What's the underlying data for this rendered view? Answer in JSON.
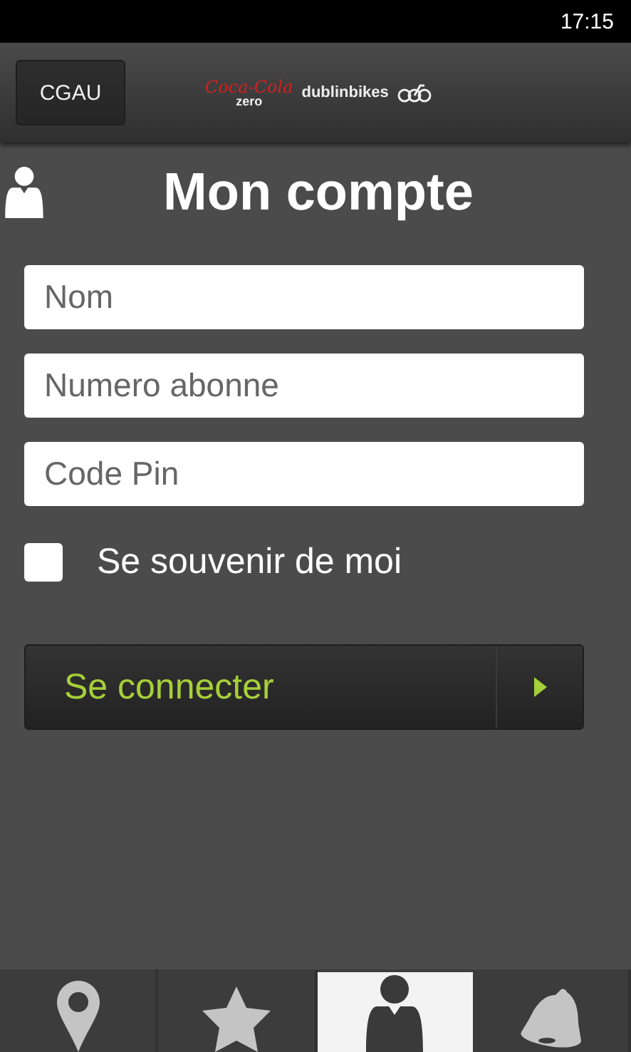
{
  "status_bar": {
    "time": "17:15"
  },
  "header": {
    "account_button": "CGAU",
    "logo": {
      "brand": "Coca-Cola",
      "sub": "zero",
      "partner": "dublinbikes"
    }
  },
  "title": "Mon compte",
  "fields": [
    {
      "placeholder": "Nom"
    },
    {
      "placeholder": "Numero abonne"
    },
    {
      "placeholder": "Code Pin"
    }
  ],
  "remember": {
    "label": "Se souvenir de moi",
    "checked": false
  },
  "connect_button": "Se connecter",
  "tabs": [
    {
      "kind": "map",
      "selected": false
    },
    {
      "kind": "favorites",
      "selected": false
    },
    {
      "kind": "account",
      "selected": true
    },
    {
      "kind": "alerts",
      "selected": false
    }
  ]
}
